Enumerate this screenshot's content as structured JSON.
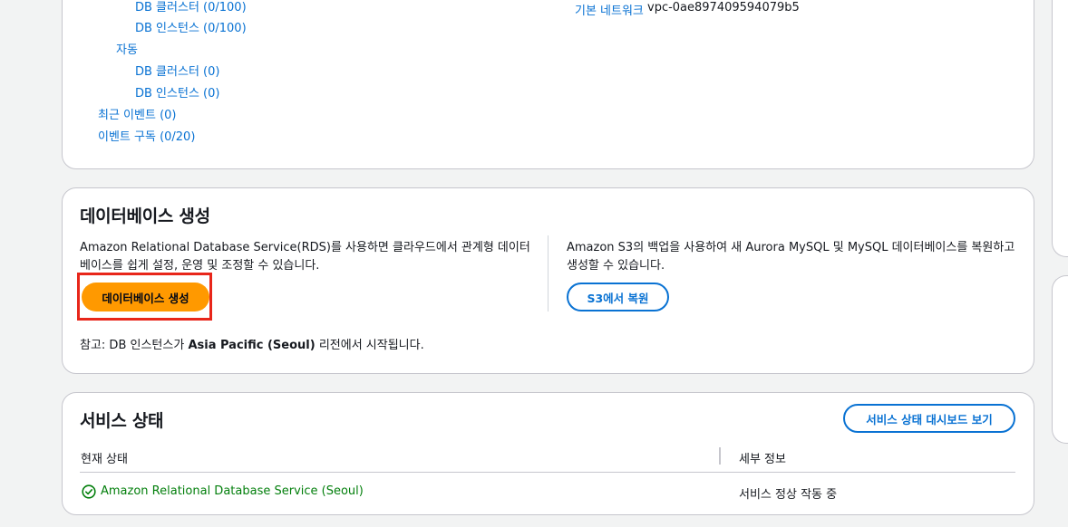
{
  "resources": {
    "items": [
      {
        "label": "DB 클러스터 (0/100)"
      },
      {
        "label": "DB 인스턴스 (0/100)"
      },
      {
        "label": "자동"
      },
      {
        "label": "DB 클러스터 (0)"
      },
      {
        "label": "DB 인스턴스 (0)"
      },
      {
        "label": "최근 이벤트 (0)"
      },
      {
        "label": "이벤트 구독 (0/20)"
      }
    ],
    "default_network_label": "기본 네트워크",
    "default_network_value": "vpc-0ae897409594079b5"
  },
  "create_db": {
    "title": "데이터베이스 생성",
    "description_line1": "Amazon Relational Database Service(RDS)를 사용하면 클라우드에서 관계형 데이터",
    "description_line2": "베이스를 쉽게 설정, 운영 및 조정할 수 있습니다.",
    "create_button": "데이터베이스 생성",
    "restore_line1": "Amazon S3의 백업을 사용하여 새 Aurora MySQL 및 MySQL 데이터베이스를 복원하고",
    "restore_line2": "생성할 수 있습니다.",
    "restore_button": "S3에서 복원",
    "note_prefix": "참고: DB 인스턴스가 ",
    "note_region": "Asia Pacific (Seoul)",
    "note_suffix": " 리전에서 시작됩니다."
  },
  "service_health": {
    "title": "서비스 상태",
    "dashboard_button": "서비스 상태 대시보드 보기",
    "columns": [
      "현재 상태",
      "세부 정보"
    ],
    "rows": [
      {
        "status": "Amazon Relational Database Service (Seoul)",
        "details": "서비스 정상 작동 중"
      }
    ]
  },
  "colors": {
    "link": "#0972d3",
    "primary": "#ff9900",
    "success": "#037f0c",
    "highlight": "#e8261a"
  }
}
